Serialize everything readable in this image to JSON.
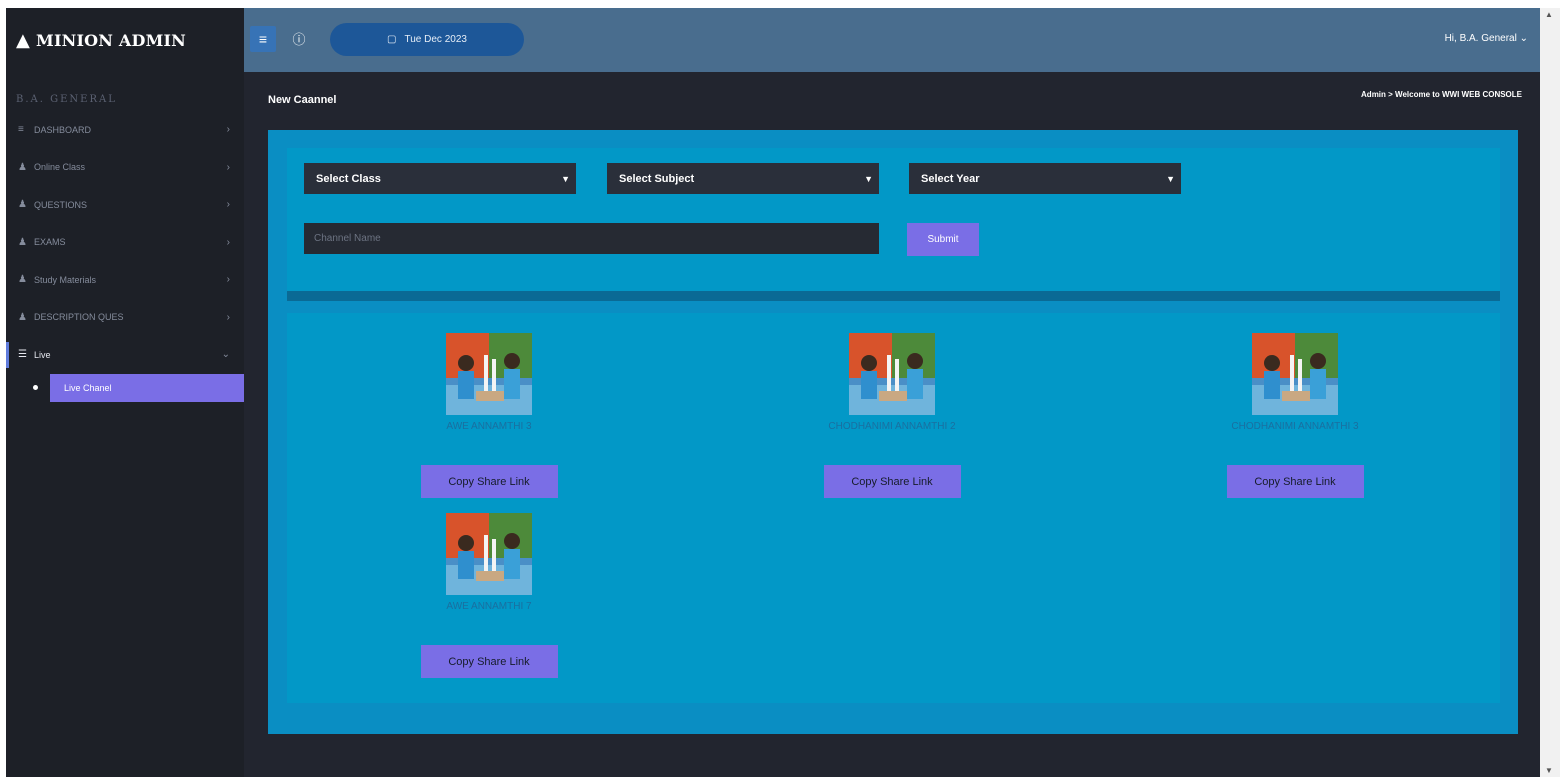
{
  "brand": {
    "logo_icon": "triangle-logo-icon",
    "name": "MINION ADMIN"
  },
  "sidebar": {
    "user_label": "B.A. GENERAL",
    "items": [
      {
        "label": "DASHBOARD",
        "icon": "list-icon"
      },
      {
        "label": "Online Class",
        "icon": "user-group-icon"
      },
      {
        "label": "QUESTIONS",
        "icon": "user-group-icon"
      },
      {
        "label": "EXAMS",
        "icon": "user-group-icon"
      },
      {
        "label": "Study Materials",
        "icon": "user-group-icon"
      },
      {
        "label": "DESCRIPTION QUES",
        "icon": "user-group-icon"
      },
      {
        "label": "Live",
        "icon": "list-icon",
        "expanded": true
      }
    ],
    "sub_items": [
      {
        "label": "Live Chanel",
        "active": true
      }
    ]
  },
  "topbar": {
    "date": "Tue Dec 2023",
    "user_greeting": "Hi, B.A. General"
  },
  "page": {
    "title": "New Caannel",
    "breadcrumb": "Admin > Welcome to WWI WEB CONSOLE"
  },
  "form": {
    "class_select": "Select Class",
    "subject_select": "Select Subject",
    "year_select": "Select Year",
    "channel_placeholder": "Channel Name",
    "submit_label": "Submit"
  },
  "channels": [
    {
      "name": "AWE ANNAMTHI 3",
      "button": "Copy Share Link"
    },
    {
      "name": "CHODHANIMI ANNAMTHI 2",
      "button": "Copy Share Link"
    },
    {
      "name": "CHODHANIMI ANNAMTHI 3",
      "button": "Copy Share Link"
    },
    {
      "name": "AWE ANNAMTHI 7",
      "button": "Copy Share Link"
    }
  ],
  "colors": {
    "sidebar": "#1d2027",
    "topbar": "#496d8e",
    "card": "#0a8ec3",
    "button": "#7a6ee6",
    "date_pill": "#1d5798"
  }
}
